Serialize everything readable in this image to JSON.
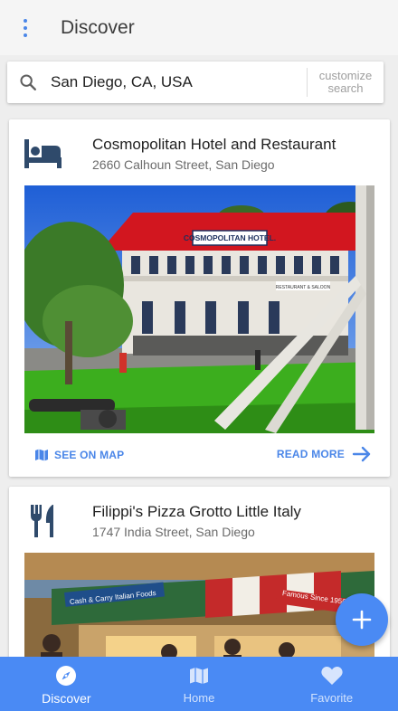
{
  "appbar": {
    "title": "Discover"
  },
  "search": {
    "value": "San Diego, CA, USA",
    "customize_label": "customize search"
  },
  "cards": [
    {
      "title": "Cosmopolitan Hotel and Restaurant",
      "address": "2660 Calhoun Street, San Diego",
      "icon": "hotel-bed-icon",
      "sign_text": "COSMOPOLITAN HOTEL.",
      "sub_sign_text": "RESTAURANT & SALOON",
      "see_on_map_label": "SEE ON MAP",
      "read_more_label": "READ MORE"
    },
    {
      "title": "Filippi's Pizza Grotto Little Italy",
      "address": "1747 India Street, San Diego",
      "icon": "fork-knife-icon",
      "sign_text": "Cash & Carry Italian Foods",
      "sign_text_2": "Famous Since 1950"
    }
  ],
  "bottom_nav": {
    "items": [
      {
        "label": "Discover",
        "icon": "compass-icon",
        "active": true
      },
      {
        "label": "Home",
        "icon": "map-icon",
        "active": false
      },
      {
        "label": "Favorite",
        "icon": "heart-icon",
        "active": false
      }
    ]
  },
  "colors": {
    "accent": "#4a8af4",
    "icon_dark": "#2f4a6b",
    "link": "#4a86e8"
  }
}
